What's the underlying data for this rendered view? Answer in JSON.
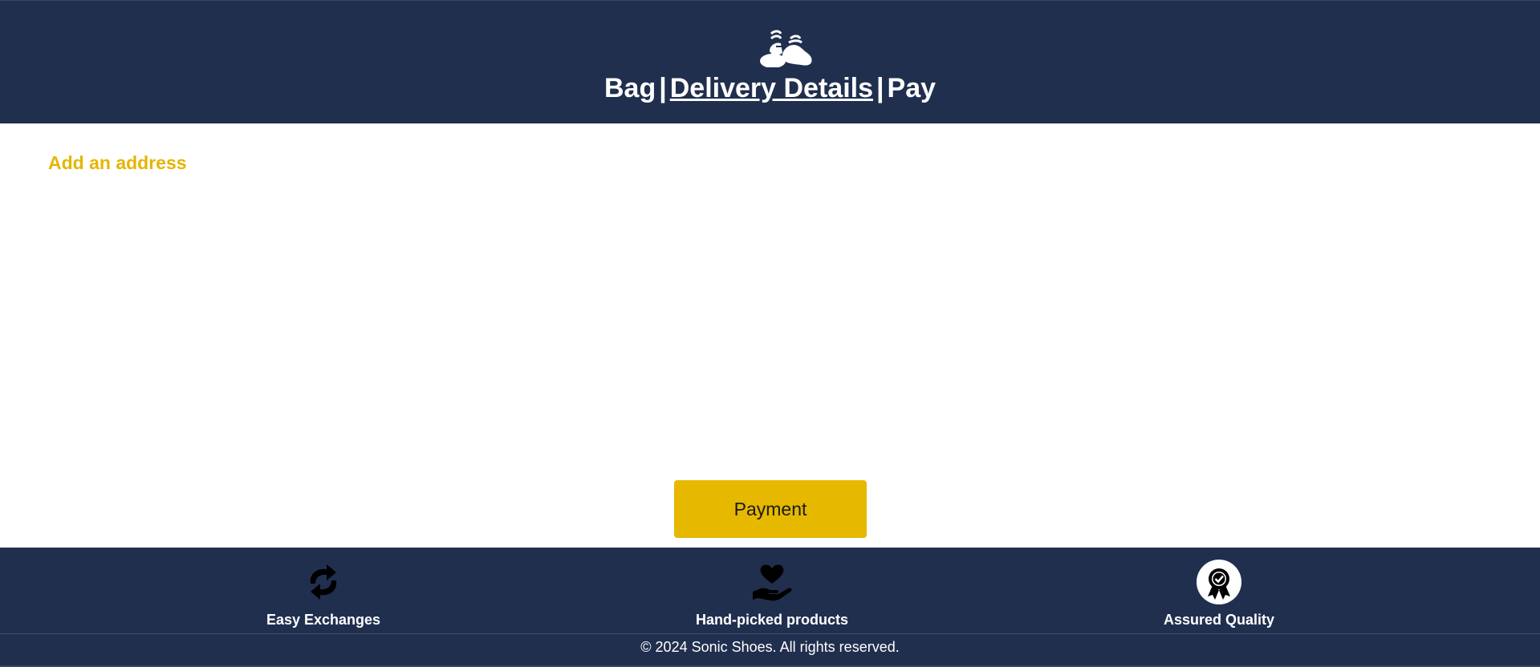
{
  "header": {
    "logo_icon": "shoes-icon",
    "steps": [
      {
        "label": "Bag",
        "active": false
      },
      {
        "label": "Delivery Details",
        "active": true
      },
      {
        "label": "Pay",
        "active": false
      }
    ],
    "separator": "|"
  },
  "main": {
    "add_address_label": "Add an address",
    "payment_button_label": "Payment"
  },
  "footer": {
    "features": [
      {
        "label": "Easy Exchanges",
        "icon": "exchange-arrows-icon"
      },
      {
        "label": "Hand-picked products",
        "icon": "hand-heart-icon"
      },
      {
        "label": "Assured Quality",
        "icon": "quality-badge-icon"
      }
    ],
    "copyright": "© 2024 Sonic Shoes. All rights reserved."
  },
  "colors": {
    "navy": "#212f4f",
    "accent_yellow": "#e6b800",
    "link_yellow": "#e5b500",
    "white": "#ffffff"
  }
}
